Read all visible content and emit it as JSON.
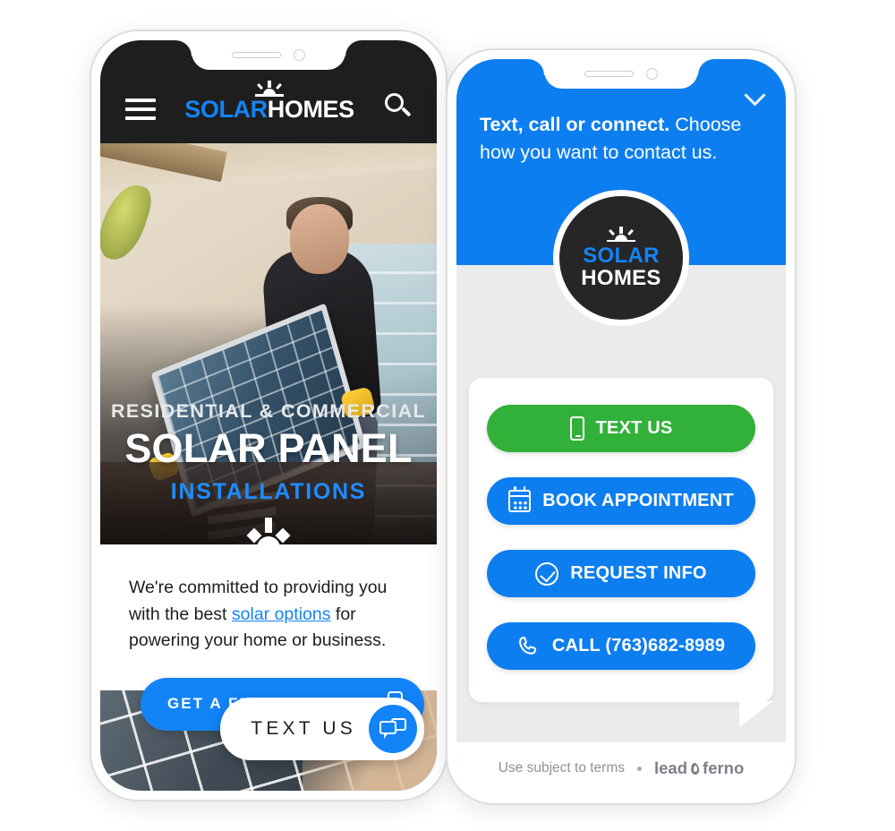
{
  "left_phone": {
    "site_header": {
      "menu_icon": "hamburger-icon",
      "logo_first": "SOLAR",
      "logo_second": "HOMES",
      "search_icon": "search-icon"
    },
    "hero": {
      "eyebrow": "RESIDENTIAL & COMMERCIAL",
      "headline": "SOLAR PANEL",
      "subhead": "INSTALLATIONS",
      "badge_icon": "sunrise-icon"
    },
    "intro": {
      "before_link": "We're committed to providing you with the best ",
      "link_text": "solar options",
      "after_link": " for powering your home or business."
    },
    "cta": {
      "estimate_label": "GET A FREE ESTIMATE",
      "estimate_icon": "mobile-phone-icon"
    },
    "widget": {
      "text_us_label": "TEXT US",
      "chat_icon": "chat-bubbles-icon"
    }
  },
  "right_phone": {
    "messenger": {
      "greeting_bold": "Text, call or connect.",
      "greeting_rest": " Choose how you want to contact us.",
      "collapse_icon": "chevron-down-icon",
      "avatar": {
        "icon": "sunrise-icon",
        "line1": "SOLAR",
        "line2": "HOMES"
      },
      "actions": [
        {
          "label": "TEXT US",
          "icon": "mobile-phone-icon",
          "color": "#32b13a",
          "style": "green"
        },
        {
          "label": "BOOK APPOINTMENT",
          "icon": "calendar-icon",
          "color": "#0d7ef0",
          "style": "blue"
        },
        {
          "label": "REQUEST INFO",
          "icon": "check-circle-icon",
          "color": "#0d7ef0",
          "style": "blue"
        },
        {
          "label": "CALL (763)682-8989",
          "icon": "phone-handset-icon",
          "color": "#0d7ef0",
          "style": "blue"
        }
      ],
      "footer": {
        "terms": "Use subject to terms",
        "separator": "•",
        "brand_first": "lead",
        "brand_icon": "flame-icon",
        "brand_second": "ferno"
      }
    }
  },
  "colors": {
    "brand_blue": "#0d7ef0",
    "logo_blue": "#1284f7",
    "green": "#32b13a",
    "header_dark": "#1e1e1e",
    "avatar_dark": "#262626",
    "messenger_bg": "#eaebed",
    "muted_text": "#8d9299"
  }
}
